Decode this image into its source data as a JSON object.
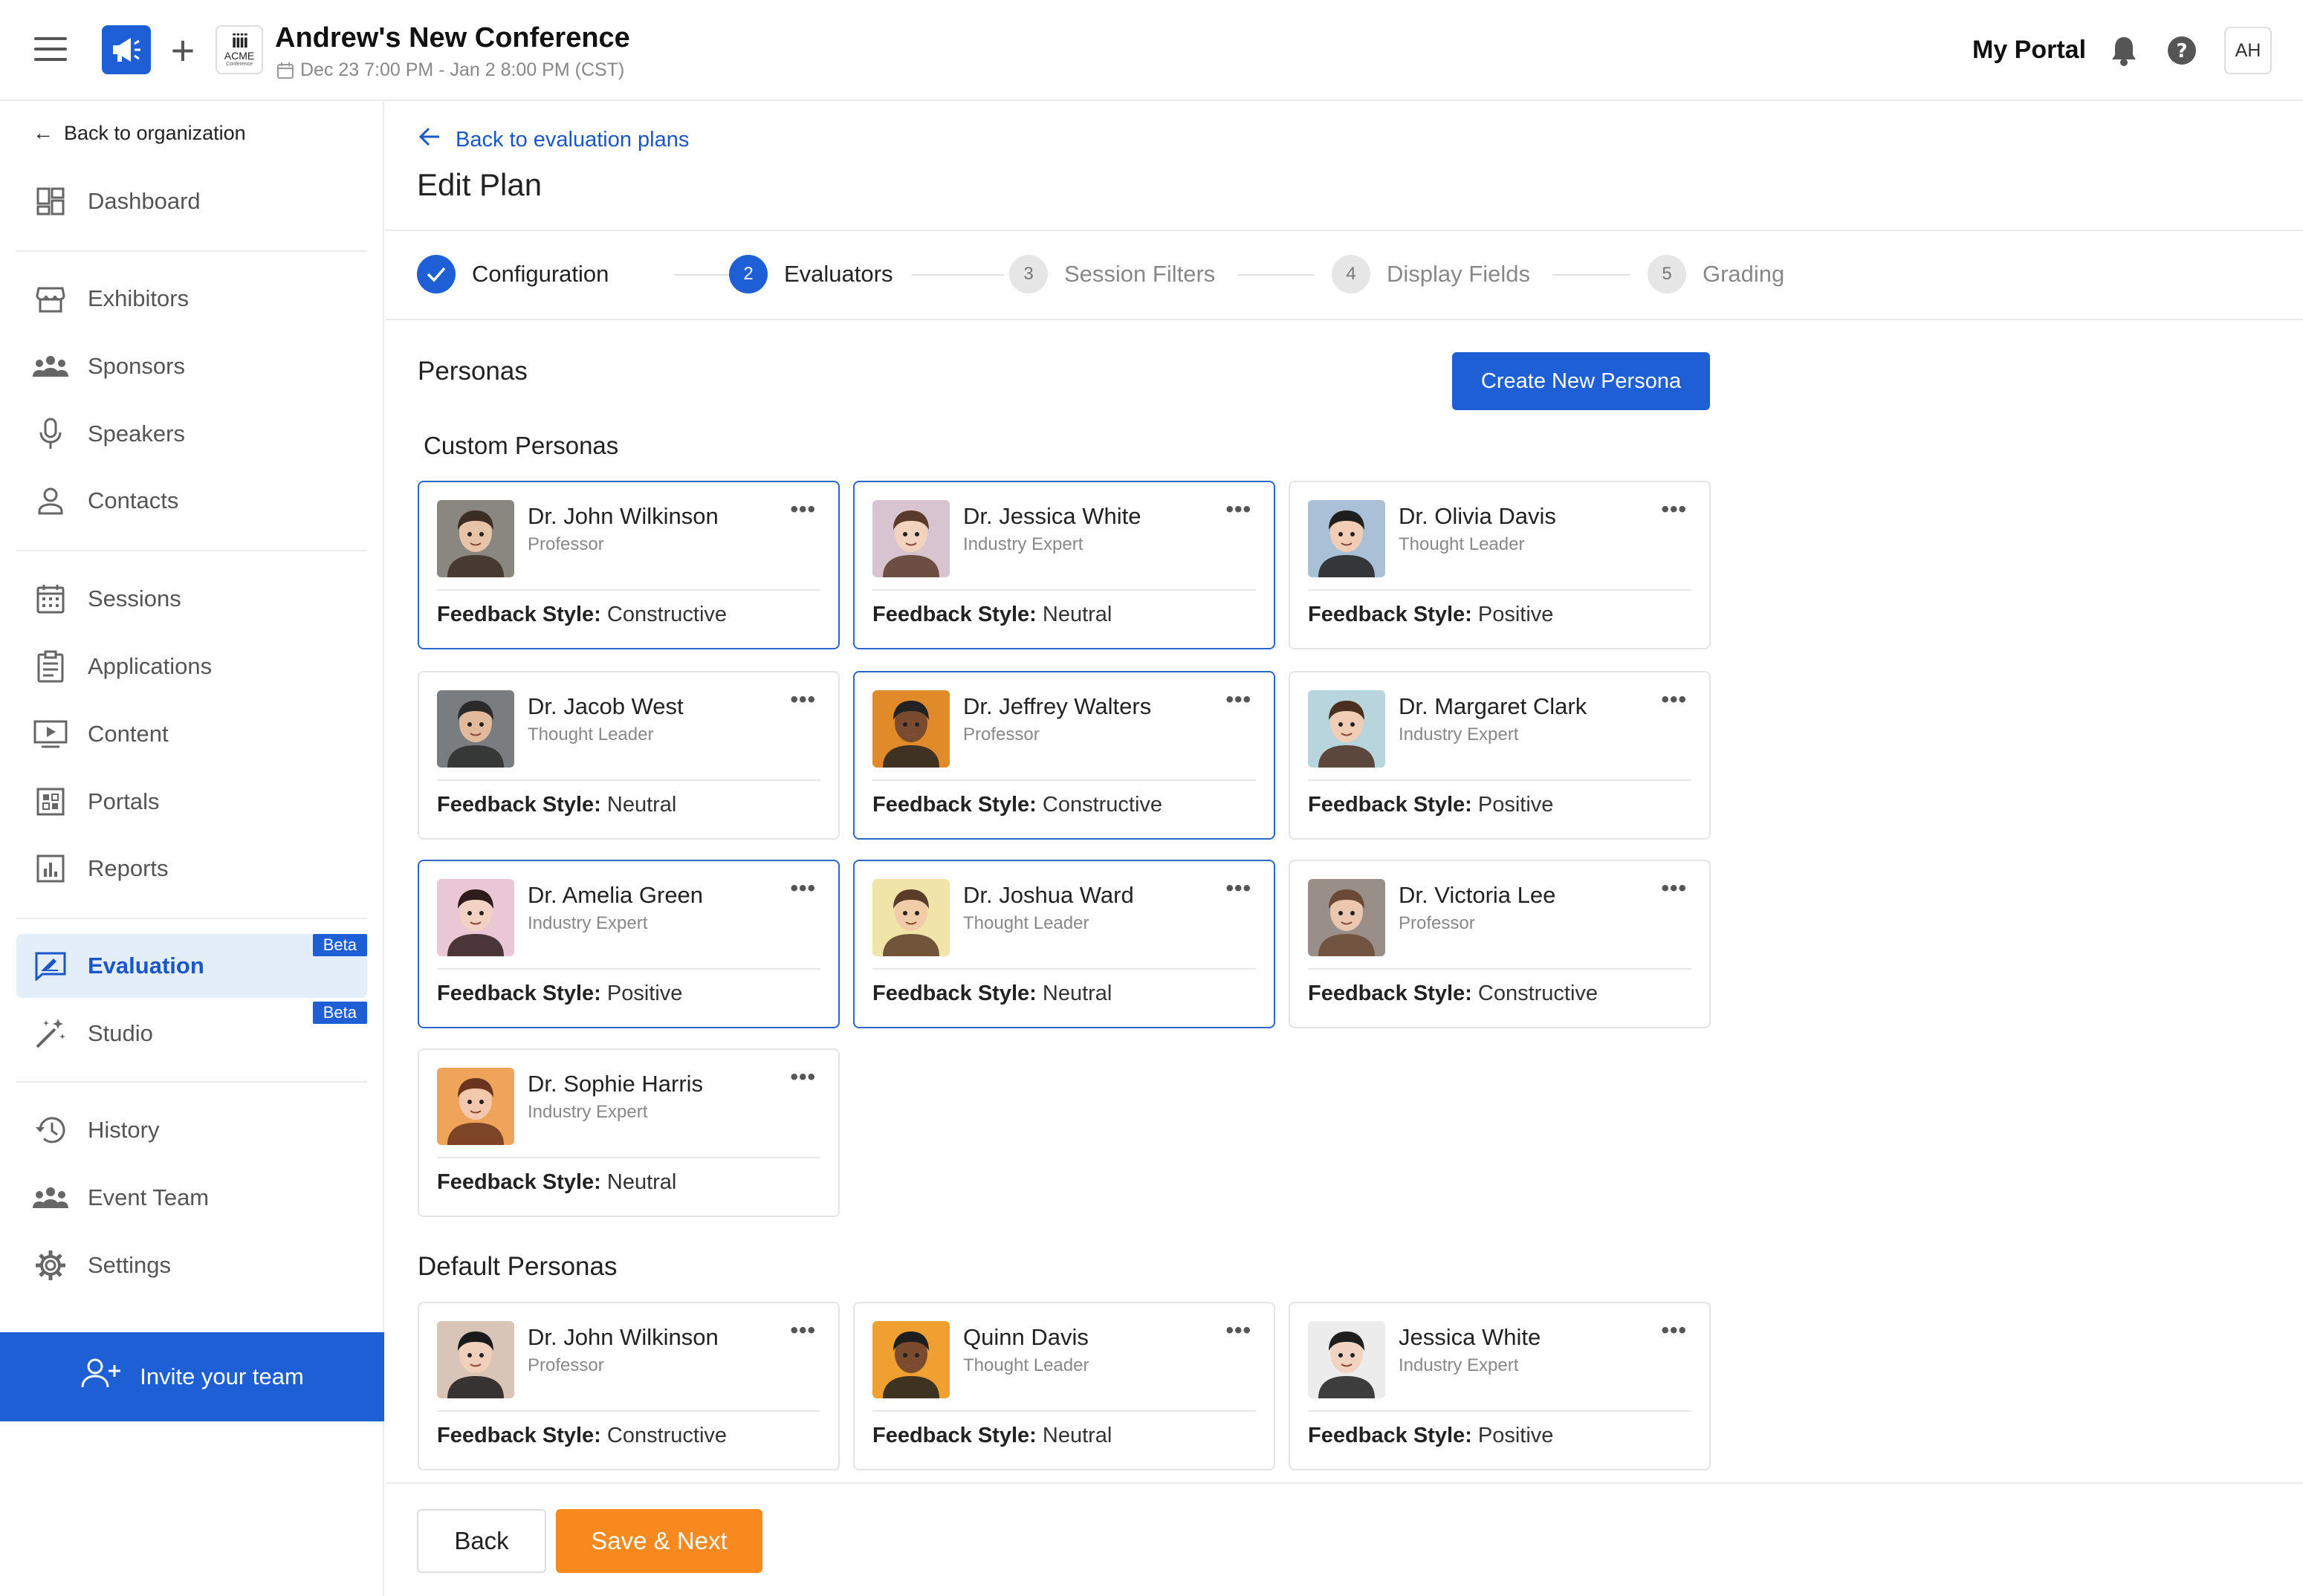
{
  "topbar": {
    "event_title": "Andrew's New Conference",
    "event_dates": "Dec 23 7:00 PM - Jan 2 8:00 PM (CST)",
    "acme_logo_text": "ACME",
    "acme_logo_sub": "Conference",
    "portal_label": "My Portal",
    "user_initials": "AH"
  },
  "sidebar": {
    "back_label": "Back to organization",
    "items": [
      {
        "label": "Dashboard",
        "icon": "dashboard-icon"
      },
      {
        "label": "Exhibitors",
        "icon": "storefront-icon"
      },
      {
        "label": "Sponsors",
        "icon": "group-icon"
      },
      {
        "label": "Speakers",
        "icon": "microphone-icon"
      },
      {
        "label": "Contacts",
        "icon": "person-icon"
      },
      {
        "label": "Sessions",
        "icon": "calendar-icon"
      },
      {
        "label": "Applications",
        "icon": "clipboard-icon"
      },
      {
        "label": "Content",
        "icon": "play-icon"
      },
      {
        "label": "Portals",
        "icon": "grid-icon"
      },
      {
        "label": "Reports",
        "icon": "chart-icon"
      },
      {
        "label": "Evaluation",
        "icon": "evaluation-icon",
        "badge": "Beta"
      },
      {
        "label": "Studio",
        "icon": "magic-wand-icon",
        "badge": "Beta"
      },
      {
        "label": "History",
        "icon": "history-icon"
      },
      {
        "label": "Event Team",
        "icon": "team-icon"
      },
      {
        "label": "Settings",
        "icon": "gear-icon"
      }
    ],
    "active_item": "Evaluation",
    "invite_label": "Invite your team"
  },
  "main": {
    "back_label": "Back to evaluation plans",
    "title": "Edit Plan",
    "steps": [
      {
        "label": "Configuration",
        "state": "done",
        "number": "1"
      },
      {
        "label": "Evaluators",
        "state": "current",
        "number": "2"
      },
      {
        "label": "Session Filters",
        "state": "todo",
        "number": "3"
      },
      {
        "label": "Display Fields",
        "state": "todo",
        "number": "4"
      },
      {
        "label": "Grading",
        "state": "todo",
        "number": "5"
      }
    ],
    "personas_title": "Personas",
    "create_button": "Create New Persona",
    "custom_title": "Custom Personas",
    "default_title": "Default Personas",
    "feedback_label": "Feedback Style:",
    "custom_personas": [
      {
        "name": "Dr. John Wilkinson",
        "role": "Professor",
        "feedback": "Constructive",
        "selected": true
      },
      {
        "name": "Dr. Jessica White",
        "role": "Industry Expert",
        "feedback": "Neutral",
        "selected": true
      },
      {
        "name": "Dr. Olivia Davis",
        "role": "Thought Leader",
        "feedback": "Positive",
        "selected": false
      },
      {
        "name": "Dr. Jacob West",
        "role": "Thought Leader",
        "feedback": "Neutral",
        "selected": false
      },
      {
        "name": "Dr. Jeffrey Walters",
        "role": "Professor",
        "feedback": "Constructive",
        "selected": true
      },
      {
        "name": "Dr. Margaret Clark",
        "role": "Industry Expert",
        "feedback": "Positive",
        "selected": false
      },
      {
        "name": "Dr. Amelia Green",
        "role": "Industry Expert",
        "feedback": "Positive",
        "selected": true
      },
      {
        "name": "Dr. Joshua Ward",
        "role": "Thought Leader",
        "feedback": "Neutral",
        "selected": true
      },
      {
        "name": "Dr. Victoria Lee",
        "role": "Professor",
        "feedback": "Constructive",
        "selected": false
      },
      {
        "name": "Dr. Sophie Harris",
        "role": "Industry Expert",
        "feedback": "Neutral",
        "selected": false
      }
    ],
    "default_personas": [
      {
        "name": "Dr. John Wilkinson",
        "role": "Professor",
        "feedback": "Constructive",
        "selected": false
      },
      {
        "name": "Quinn Davis",
        "role": "Thought Leader",
        "feedback": "Neutral",
        "selected": false
      },
      {
        "name": "Jessica White",
        "role": "Industry Expert",
        "feedback": "Positive",
        "selected": false
      }
    ]
  },
  "footer": {
    "back_label": "Back",
    "save_label": "Save & Next"
  },
  "colors": {
    "accent": "#1f5fd6",
    "save": "#f7891f",
    "active_bg": "#e4eefb"
  }
}
